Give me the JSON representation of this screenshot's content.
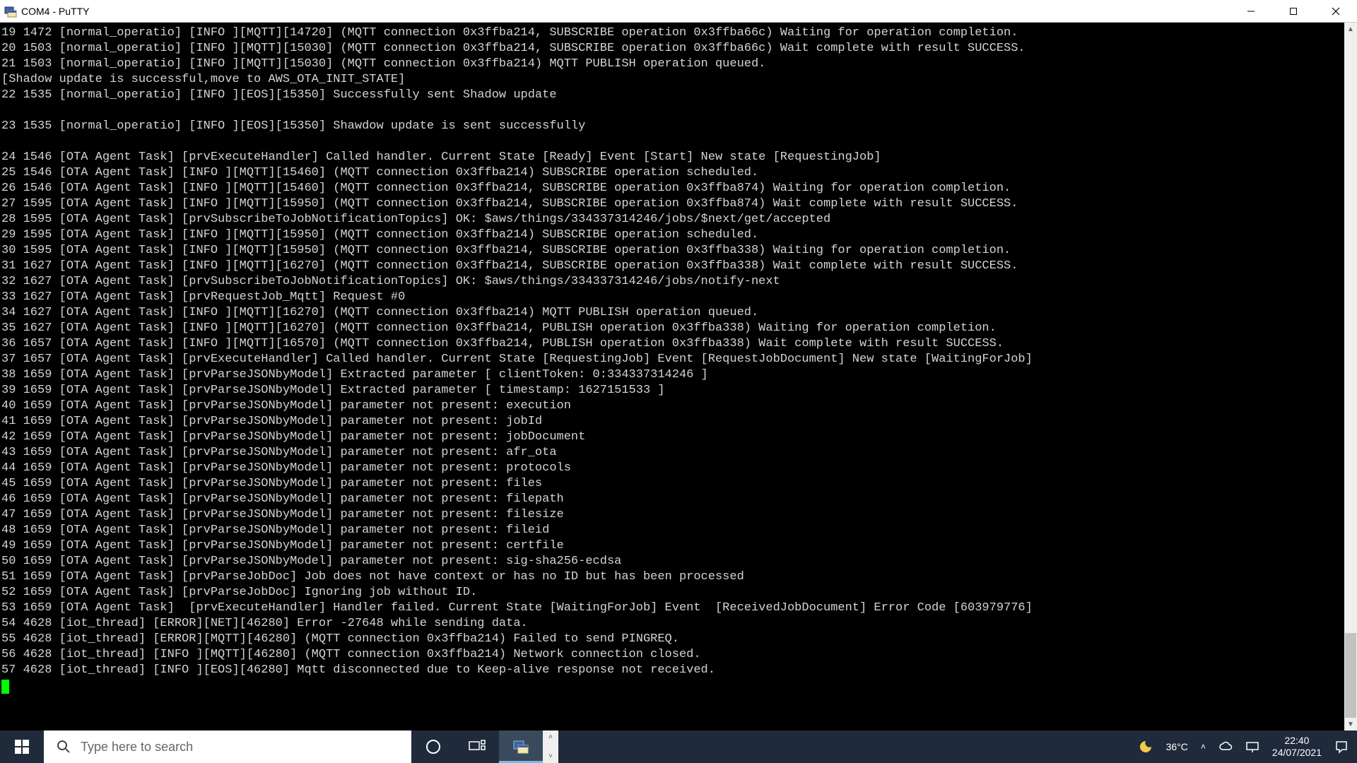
{
  "window": {
    "title": "COM4 - PuTTY"
  },
  "search": {
    "placeholder": "Type here to search"
  },
  "weather": {
    "temp": "36°C"
  },
  "clock": {
    "time": "22:40",
    "date": "24/07/2021"
  },
  "log_lines": [
    "19 1472 [normal_operatio] [INFO ][MQTT][14720] (MQTT connection 0x3ffba214, SUBSCRIBE operation 0x3ffba66c) Waiting for operation completion.",
    "20 1503 [normal_operatio] [INFO ][MQTT][15030] (MQTT connection 0x3ffba214, SUBSCRIBE operation 0x3ffba66c) Wait complete with result SUCCESS.",
    "21 1503 [normal_operatio] [INFO ][MQTT][15030] (MQTT connection 0x3ffba214) MQTT PUBLISH operation queued.",
    "[Shadow update is successful,move to AWS_OTA_INIT_STATE]",
    "22 1535 [normal_operatio] [INFO ][EOS][15350] Successfully sent Shadow update",
    "",
    "23 1535 [normal_operatio] [INFO ][EOS][15350] Shawdow update is sent successfully",
    "",
    "24 1546 [OTA Agent Task] [prvExecuteHandler] Called handler. Current State [Ready] Event [Start] New state [RequestingJob]",
    "25 1546 [OTA Agent Task] [INFO ][MQTT][15460] (MQTT connection 0x3ffba214) SUBSCRIBE operation scheduled.",
    "26 1546 [OTA Agent Task] [INFO ][MQTT][15460] (MQTT connection 0x3ffba214, SUBSCRIBE operation 0x3ffba874) Waiting for operation completion.",
    "27 1595 [OTA Agent Task] [INFO ][MQTT][15950] (MQTT connection 0x3ffba214, SUBSCRIBE operation 0x3ffba874) Wait complete with result SUCCESS.",
    "28 1595 [OTA Agent Task] [prvSubscribeToJobNotificationTopics] OK: $aws/things/334337314246/jobs/$next/get/accepted",
    "29 1595 [OTA Agent Task] [INFO ][MQTT][15950] (MQTT connection 0x3ffba214) SUBSCRIBE operation scheduled.",
    "30 1595 [OTA Agent Task] [INFO ][MQTT][15950] (MQTT connection 0x3ffba214, SUBSCRIBE operation 0x3ffba338) Waiting for operation completion.",
    "31 1627 [OTA Agent Task] [INFO ][MQTT][16270] (MQTT connection 0x3ffba214, SUBSCRIBE operation 0x3ffba338) Wait complete with result SUCCESS.",
    "32 1627 [OTA Agent Task] [prvSubscribeToJobNotificationTopics] OK: $aws/things/334337314246/jobs/notify-next",
    "33 1627 [OTA Agent Task] [prvRequestJob_Mqtt] Request #0",
    "34 1627 [OTA Agent Task] [INFO ][MQTT][16270] (MQTT connection 0x3ffba214) MQTT PUBLISH operation queued.",
    "35 1627 [OTA Agent Task] [INFO ][MQTT][16270] (MQTT connection 0x3ffba214, PUBLISH operation 0x3ffba338) Waiting for operation completion.",
    "36 1657 [OTA Agent Task] [INFO ][MQTT][16570] (MQTT connection 0x3ffba214, PUBLISH operation 0x3ffba338) Wait complete with result SUCCESS.",
    "37 1657 [OTA Agent Task] [prvExecuteHandler] Called handler. Current State [RequestingJob] Event [RequestJobDocument] New state [WaitingForJob]",
    "38 1659 [OTA Agent Task] [prvParseJSONbyModel] Extracted parameter [ clientToken: 0:334337314246 ]",
    "39 1659 [OTA Agent Task] [prvParseJSONbyModel] Extracted parameter [ timestamp: 1627151533 ]",
    "40 1659 [OTA Agent Task] [prvParseJSONbyModel] parameter not present: execution",
    "41 1659 [OTA Agent Task] [prvParseJSONbyModel] parameter not present: jobId",
    "42 1659 [OTA Agent Task] [prvParseJSONbyModel] parameter not present: jobDocument",
    "43 1659 [OTA Agent Task] [prvParseJSONbyModel] parameter not present: afr_ota",
    "44 1659 [OTA Agent Task] [prvParseJSONbyModel] parameter not present: protocols",
    "45 1659 [OTA Agent Task] [prvParseJSONbyModel] parameter not present: files",
    "46 1659 [OTA Agent Task] [prvParseJSONbyModel] parameter not present: filepath",
    "47 1659 [OTA Agent Task] [prvParseJSONbyModel] parameter not present: filesize",
    "48 1659 [OTA Agent Task] [prvParseJSONbyModel] parameter not present: fileid",
    "49 1659 [OTA Agent Task] [prvParseJSONbyModel] parameter not present: certfile",
    "50 1659 [OTA Agent Task] [prvParseJSONbyModel] parameter not present: sig-sha256-ecdsa",
    "51 1659 [OTA Agent Task] [prvParseJobDoc] Job does not have context or has no ID but has been processed",
    "52 1659 [OTA Agent Task] [prvParseJobDoc] Ignoring job without ID.",
    "53 1659 [OTA Agent Task]  [prvExecuteHandler] Handler failed. Current State [WaitingForJob] Event  [ReceivedJobDocument] Error Code [603979776]",
    "54 4628 [iot_thread] [ERROR][NET][46280] Error -27648 while sending data.",
    "55 4628 [iot_thread] [ERROR][MQTT][46280] (MQTT connection 0x3ffba214) Failed to send PINGREQ.",
    "56 4628 [iot_thread] [INFO ][MQTT][46280] (MQTT connection 0x3ffba214) Network connection closed.",
    "57 4628 [iot_thread] [INFO ][EOS][46280] Mqtt disconnected due to Keep-alive response not received."
  ]
}
